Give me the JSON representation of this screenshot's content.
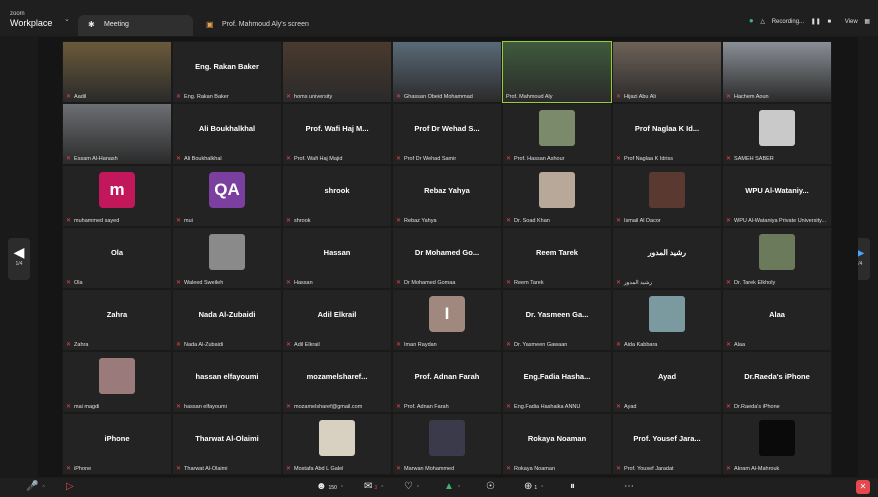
{
  "app": {
    "brand_small": "zoom",
    "brand_big": "Workplace"
  },
  "tabs": [
    {
      "label": "Meeting",
      "icon": "meeting-icon"
    },
    {
      "label": "Prof. Mahmoud Aly's screen",
      "icon": "screen-share-icon"
    }
  ],
  "top_right": {
    "recording": "Recording...",
    "view": "View"
  },
  "nav": {
    "left_page": "1/4",
    "right_page": "1/4"
  },
  "tiles": [
    {
      "display": "Aadil",
      "label": "Aadil",
      "muted": true,
      "type": "video",
      "bg": "#6b5a3a"
    },
    {
      "display": "Eng. Rakan Baker",
      "label": "Eng. Rakan Baker",
      "muted": true,
      "type": "name"
    },
    {
      "display": "homs university",
      "label": "homs university",
      "muted": true,
      "type": "video",
      "bg": "#4a3a2e"
    },
    {
      "display": "Ghassan Obeid Mohammad",
      "label": "Ghassan Obeid Mohammad",
      "muted": true,
      "type": "video",
      "bg": "#5a6a78"
    },
    {
      "display": "Prof. Mahmoud Aly",
      "label": "Prof. Mahmoud Aly",
      "muted": false,
      "type": "video",
      "bg": "#3f5a3c",
      "speaker": true
    },
    {
      "display": "Hijazi Abu Ali",
      "label": "Hijazi Abu Ali",
      "muted": true,
      "type": "video",
      "bg": "#6e6259"
    },
    {
      "display": "Hachem Aoun",
      "label": "Hachem Aoun",
      "muted": true,
      "type": "video",
      "bg": "#8a8f96"
    },
    {
      "display": "Essam Al-Hanash",
      "label": "Essam Al-Hanash",
      "muted": true,
      "type": "video",
      "bg": "#6c6f73"
    },
    {
      "display": "Ali Boukhalkhal",
      "label": "Ali Boukhalkhal",
      "muted": true,
      "type": "name"
    },
    {
      "display": "Prof. Wafi Haj M...",
      "label": "Prof. Wafi Haj Majid",
      "muted": true,
      "type": "name"
    },
    {
      "display": "Prof Dr Wehad S...",
      "label": "Prof Dr Wehad Samir",
      "muted": true,
      "type": "name"
    },
    {
      "display": "Prof. Hassan Ashour",
      "label": "Prof. Hassan Ashour",
      "muted": true,
      "type": "photo",
      "bg": "#7a8a6a"
    },
    {
      "display": "Prof Naglaa K Id...",
      "label": "Prof Naglaa K Idriss",
      "muted": true,
      "type": "name"
    },
    {
      "display": "SAMEH SABER",
      "label": "SAMEH SABER",
      "muted": true,
      "type": "photo",
      "bg": "#c9c9c9"
    },
    {
      "display": "m",
      "label": "muhammed sayed",
      "muted": true,
      "type": "avatar",
      "bg": "#c2185b"
    },
    {
      "display": "QA",
      "label": "mui",
      "muted": true,
      "type": "avatar",
      "bg": "#7b3fa0"
    },
    {
      "display": "shrook",
      "label": "shrook",
      "muted": true,
      "type": "name"
    },
    {
      "display": "Rebaz Yahya",
      "label": "Rebaz Yahya",
      "muted": true,
      "type": "name"
    },
    {
      "display": "Dr. Soad Khan",
      "label": "Dr. Soad Khan",
      "muted": true,
      "type": "photo",
      "bg": "#b8a89a"
    },
    {
      "display": "Ismail Al Dacor",
      "label": "Ismail Al Dacor",
      "muted": true,
      "type": "photo",
      "bg": "#5a3a30"
    },
    {
      "display": "WPU Al-Wataniy...",
      "label": "WPU Al-Wataniya Private University...",
      "muted": true,
      "type": "name"
    },
    {
      "display": "Ola",
      "label": "Ola",
      "muted": true,
      "type": "name"
    },
    {
      "display": "Waleed Sweileh",
      "label": "Waleed Sweileh",
      "muted": true,
      "type": "photo",
      "bg": "#8a8a8a"
    },
    {
      "display": "Hassan",
      "label": "Hassan",
      "muted": true,
      "type": "name"
    },
    {
      "display": "Dr Mohamed Go...",
      "label": "Dr Mohamed Gomaa",
      "muted": true,
      "type": "name"
    },
    {
      "display": "Reem Tarek",
      "label": "Reem Tarek",
      "muted": true,
      "type": "name"
    },
    {
      "display": "رشيد المدور",
      "label": "رشيد المدور",
      "muted": true,
      "type": "name"
    },
    {
      "display": "Dr. Tarek Elkholy",
      "label": "Dr. Tarek Elkholy",
      "muted": true,
      "type": "photo",
      "bg": "#6a7a5a"
    },
    {
      "display": "Zahra",
      "label": "Zahra",
      "muted": true,
      "type": "name"
    },
    {
      "display": "Nada Al-Zubaidi",
      "label": "Nada Al-Zubaidi",
      "muted": true,
      "type": "name"
    },
    {
      "display": "Adil Elkrail",
      "label": "Adil Elkrail",
      "muted": true,
      "type": "name"
    },
    {
      "display": "I",
      "label": "Iman Raydan",
      "muted": true,
      "type": "avatar",
      "bg": "#a1887f"
    },
    {
      "display": "Dr. Yasmeen Ga...",
      "label": "Dr. Yasmeen Gawaan",
      "muted": true,
      "type": "name"
    },
    {
      "display": "Aida Kabbara",
      "label": "Aida Kabbara",
      "muted": true,
      "type": "photo",
      "bg": "#7a9aa0"
    },
    {
      "display": "Alaa",
      "label": "Alaa",
      "muted": true,
      "type": "name"
    },
    {
      "display": "mai magdi",
      "label": "mai magdi",
      "muted": true,
      "type": "photo",
      "bg": "#9a7a7a"
    },
    {
      "display": "hassan elfayoumi",
      "label": "hassan elfayoumi",
      "muted": true,
      "type": "name"
    },
    {
      "display": "mozamelsharef...",
      "label": "mozamelsharef@gmail.com",
      "muted": true,
      "type": "name"
    },
    {
      "display": "Prof. Adnan Farah",
      "label": "Prof. Adnan Farah",
      "muted": true,
      "type": "name"
    },
    {
      "display": "Eng.Fadia Hasha...",
      "label": "Eng.Fadia Hashaika ANNU",
      "muted": true,
      "type": "name"
    },
    {
      "display": "Ayad",
      "label": "Ayad",
      "muted": true,
      "type": "name"
    },
    {
      "display": "Dr.Raeda's iPhone",
      "label": "Dr.Raeda's iPhone",
      "muted": true,
      "type": "name"
    },
    {
      "display": "iPhone",
      "label": "iPhone",
      "muted": true,
      "type": "name"
    },
    {
      "display": "Tharwat Al-Olaimi",
      "label": "Tharwat Al-Olaimi",
      "muted": true,
      "type": "name"
    },
    {
      "display": "Mostafa Abd L Galel",
      "label": "Mostafa Abd L Galel",
      "muted": true,
      "type": "photo",
      "bg": "#d8d0c0"
    },
    {
      "display": "Marwan Mohammed",
      "label": "Marwan Mohammed",
      "muted": true,
      "type": "photo",
      "bg": "#3a3a4a"
    },
    {
      "display": "Rokaya Noaman",
      "label": "Rokaya Noaman",
      "muted": true,
      "type": "name"
    },
    {
      "display": "Prof. Yousef Jara...",
      "label": "Prof. Yousef Jaradat",
      "muted": true,
      "type": "name"
    },
    {
      "display": "Akram Al-Mahrouk",
      "label": "Akram Al-Mahrouk",
      "muted": true,
      "type": "photo",
      "bg": "#0a0a0a"
    }
  ],
  "toolbar": {
    "participants_count": "150",
    "chat_badge": "3",
    "reactions_count": "1"
  },
  "colors": {
    "accent_green": "#3cb371",
    "mute_red": "#e5484d",
    "active_speaker": "#9acd32"
  }
}
